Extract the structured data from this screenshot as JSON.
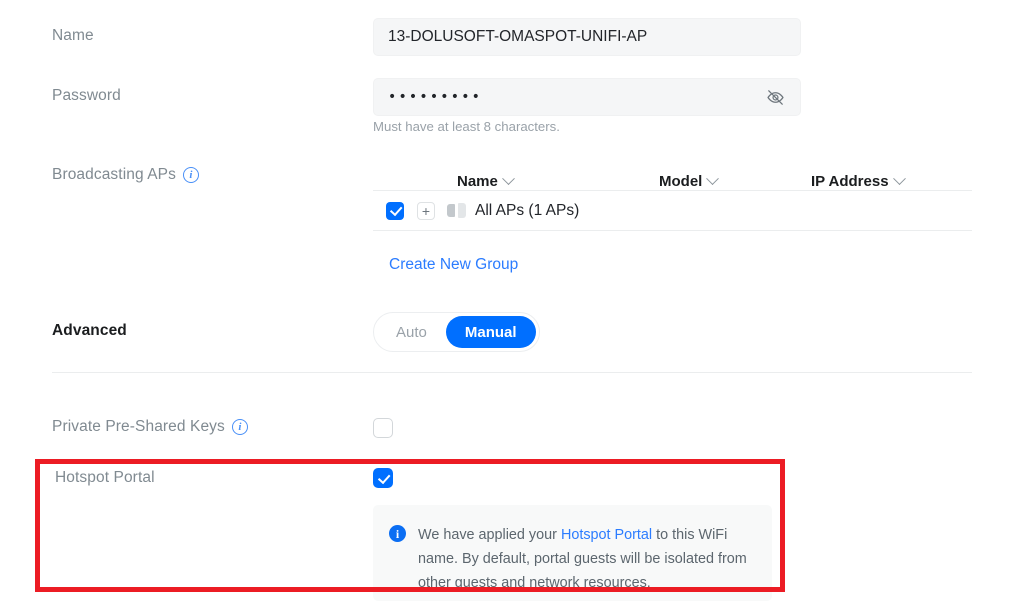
{
  "form": {
    "name": {
      "label": "Name",
      "value": "13-DOLUSOFT-OMASPOT-UNIFI-AP",
      "placeholder": "Name"
    },
    "password": {
      "label": "Password",
      "value": "•••••••••",
      "helper": "Must have at least 8 characters.",
      "reveal_icon": "eye-off-icon"
    },
    "broadcasting_aps": {
      "label": "Broadcasting APs",
      "info_icon": "info-icon",
      "columns": [
        "Name",
        "Model",
        "IP Address"
      ],
      "rows": [
        {
          "checked": true,
          "expand_icon": "plus-icon",
          "device_icon": "access-point-icon",
          "name": "All APs (1 APs)",
          "model": "",
          "ip_address": ""
        }
      ],
      "create_group_link": "Create New Group"
    },
    "advanced": {
      "label": "Advanced",
      "options": [
        "Auto",
        "Manual"
      ],
      "selected": "Manual"
    },
    "private_psk": {
      "label": "Private Pre-Shared Keys",
      "info_icon": "info-icon",
      "checked": false
    },
    "hotspot_portal": {
      "label": "Hotspot Portal",
      "checked": true,
      "callout": {
        "icon": "info-filled-icon",
        "text_before": "We have applied your ",
        "link_text": "Hotspot Portal",
        "text_after": " to this WiFi name. By default, portal guests will be isolated from other guests and network resources."
      }
    }
  },
  "colors": {
    "accent_blue": "#006fff",
    "link_blue": "#2b7cff",
    "highlight_red": "#ec1c24",
    "label_gray": "#808a91",
    "input_bg": "#f5f6f7"
  }
}
